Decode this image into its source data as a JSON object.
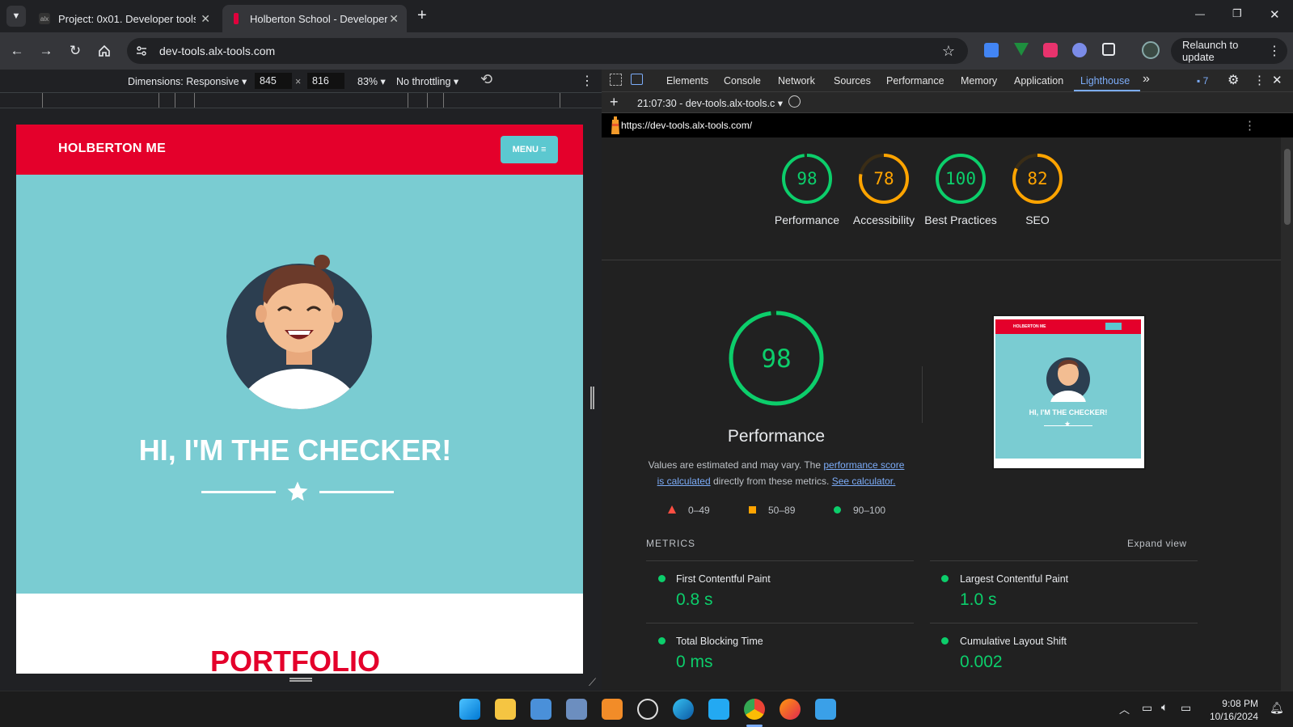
{
  "tabs": [
    {
      "title": "Project: 0x01. Developer tools |",
      "close": "✕"
    },
    {
      "title": "Holberton School - Developer t",
      "close": "✕"
    }
  ],
  "new_tab": "+",
  "window_controls": {
    "minimize": "—",
    "restore": "❐",
    "close": "✕"
  },
  "toolbar": {
    "url": "dev-tools.alx-tools.com",
    "relaunch": "Relaunch to update"
  },
  "device_toolbar": {
    "dimensions": "Dimensions: Responsive",
    "width": "845",
    "times": "×",
    "height": "816",
    "zoom": "83%",
    "throttling": "No throttling"
  },
  "site": {
    "brand": "HOLBERTON ME",
    "menu": "MENU",
    "headline": "HI, I'M THE CHECKER!",
    "next_section": "PORTFOLIO"
  },
  "devtools": {
    "tabs": [
      "Elements",
      "Console",
      "Network",
      "Sources",
      "Performance",
      "Memory",
      "Application",
      "Lighthouse"
    ],
    "more": "»",
    "issues_count": "7",
    "report_selector": "21:07:30 - dev-tools.alx-tools.c",
    "report_url": "https://dev-tools.alx-tools.com/"
  },
  "lighthouse": {
    "scores": [
      {
        "value": "98",
        "label": "Performance",
        "color": "#0cce6b",
        "score": 0.98
      },
      {
        "value": "78",
        "label": "Accessibility",
        "color": "#ffa400",
        "score": 0.78
      },
      {
        "value": "100",
        "label": "Best Practices",
        "color": "#0cce6b",
        "score": 1.0
      },
      {
        "value": "82",
        "label": "SEO",
        "color": "#ffa400",
        "score": 0.82
      }
    ],
    "main_score": "98",
    "main_label": "Performance",
    "desc_prefix": "Values are estimated and may vary. The ",
    "desc_link1": "performance score is calculated",
    "desc_mid": " directly from these metrics. ",
    "desc_link2": "See calculator.",
    "legend": [
      {
        "range": "0–49",
        "color": "#ff4e42"
      },
      {
        "range": "50–89",
        "color": "#ffa400"
      },
      {
        "range": "90–100",
        "color": "#0cce6b"
      }
    ],
    "metrics_title": "METRICS",
    "expand": "Expand view",
    "metrics": [
      {
        "name": "First Contentful Paint",
        "value": "0.8 s"
      },
      {
        "name": "Largest Contentful Paint",
        "value": "1.0 s"
      },
      {
        "name": "Total Blocking Time",
        "value": "0 ms"
      },
      {
        "name": "Cumulative Layout Shift",
        "value": "0.002"
      }
    ],
    "thumb": {
      "brand": "HOLBERTON ME",
      "headline": "HI, I'M THE CHECKER!"
    }
  },
  "taskbar": {
    "time": "9:08 PM",
    "date": "10/16/2024"
  }
}
